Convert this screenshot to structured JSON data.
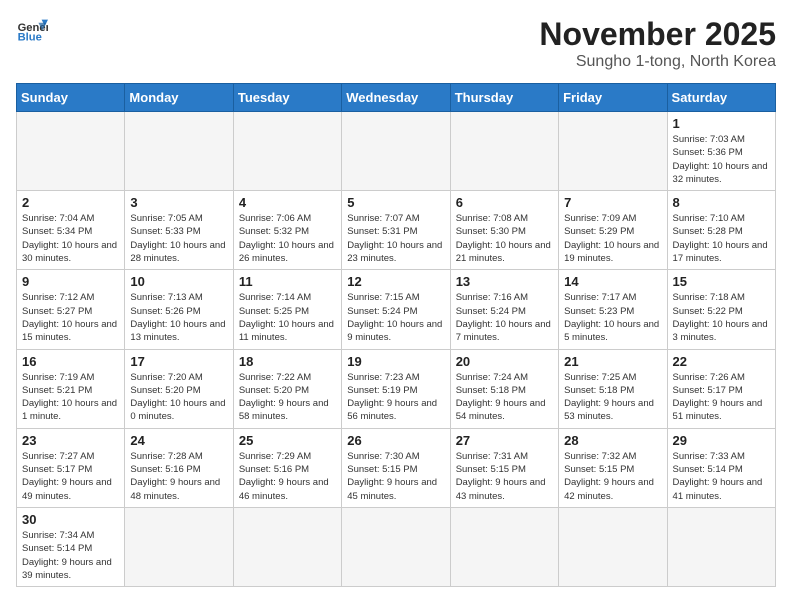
{
  "header": {
    "logo_general": "General",
    "logo_blue": "Blue",
    "month_title": "November 2025",
    "subtitle": "Sungho 1-tong, North Korea"
  },
  "weekdays": [
    "Sunday",
    "Monday",
    "Tuesday",
    "Wednesday",
    "Thursday",
    "Friday",
    "Saturday"
  ],
  "days": {
    "d1": {
      "num": "1",
      "sunrise": "7:03 AM",
      "sunset": "5:36 PM",
      "daylight": "10 hours and 32 minutes."
    },
    "d2": {
      "num": "2",
      "sunrise": "7:04 AM",
      "sunset": "5:34 PM",
      "daylight": "10 hours and 30 minutes."
    },
    "d3": {
      "num": "3",
      "sunrise": "7:05 AM",
      "sunset": "5:33 PM",
      "daylight": "10 hours and 28 minutes."
    },
    "d4": {
      "num": "4",
      "sunrise": "7:06 AM",
      "sunset": "5:32 PM",
      "daylight": "10 hours and 26 minutes."
    },
    "d5": {
      "num": "5",
      "sunrise": "7:07 AM",
      "sunset": "5:31 PM",
      "daylight": "10 hours and 23 minutes."
    },
    "d6": {
      "num": "6",
      "sunrise": "7:08 AM",
      "sunset": "5:30 PM",
      "daylight": "10 hours and 21 minutes."
    },
    "d7": {
      "num": "7",
      "sunrise": "7:09 AM",
      "sunset": "5:29 PM",
      "daylight": "10 hours and 19 minutes."
    },
    "d8": {
      "num": "8",
      "sunrise": "7:10 AM",
      "sunset": "5:28 PM",
      "daylight": "10 hours and 17 minutes."
    },
    "d9": {
      "num": "9",
      "sunrise": "7:12 AM",
      "sunset": "5:27 PM",
      "daylight": "10 hours and 15 minutes."
    },
    "d10": {
      "num": "10",
      "sunrise": "7:13 AM",
      "sunset": "5:26 PM",
      "daylight": "10 hours and 13 minutes."
    },
    "d11": {
      "num": "11",
      "sunrise": "7:14 AM",
      "sunset": "5:25 PM",
      "daylight": "10 hours and 11 minutes."
    },
    "d12": {
      "num": "12",
      "sunrise": "7:15 AM",
      "sunset": "5:24 PM",
      "daylight": "10 hours and 9 minutes."
    },
    "d13": {
      "num": "13",
      "sunrise": "7:16 AM",
      "sunset": "5:24 PM",
      "daylight": "10 hours and 7 minutes."
    },
    "d14": {
      "num": "14",
      "sunrise": "7:17 AM",
      "sunset": "5:23 PM",
      "daylight": "10 hours and 5 minutes."
    },
    "d15": {
      "num": "15",
      "sunrise": "7:18 AM",
      "sunset": "5:22 PM",
      "daylight": "10 hours and 3 minutes."
    },
    "d16": {
      "num": "16",
      "sunrise": "7:19 AM",
      "sunset": "5:21 PM",
      "daylight": "10 hours and 1 minute."
    },
    "d17": {
      "num": "17",
      "sunrise": "7:20 AM",
      "sunset": "5:20 PM",
      "daylight": "10 hours and 0 minutes."
    },
    "d18": {
      "num": "18",
      "sunrise": "7:22 AM",
      "sunset": "5:20 PM",
      "daylight": "9 hours and 58 minutes."
    },
    "d19": {
      "num": "19",
      "sunrise": "7:23 AM",
      "sunset": "5:19 PM",
      "daylight": "9 hours and 56 minutes."
    },
    "d20": {
      "num": "20",
      "sunrise": "7:24 AM",
      "sunset": "5:18 PM",
      "daylight": "9 hours and 54 minutes."
    },
    "d21": {
      "num": "21",
      "sunrise": "7:25 AM",
      "sunset": "5:18 PM",
      "daylight": "9 hours and 53 minutes."
    },
    "d22": {
      "num": "22",
      "sunrise": "7:26 AM",
      "sunset": "5:17 PM",
      "daylight": "9 hours and 51 minutes."
    },
    "d23": {
      "num": "23",
      "sunrise": "7:27 AM",
      "sunset": "5:17 PM",
      "daylight": "9 hours and 49 minutes."
    },
    "d24": {
      "num": "24",
      "sunrise": "7:28 AM",
      "sunset": "5:16 PM",
      "daylight": "9 hours and 48 minutes."
    },
    "d25": {
      "num": "25",
      "sunrise": "7:29 AM",
      "sunset": "5:16 PM",
      "daylight": "9 hours and 46 minutes."
    },
    "d26": {
      "num": "26",
      "sunrise": "7:30 AM",
      "sunset": "5:15 PM",
      "daylight": "9 hours and 45 minutes."
    },
    "d27": {
      "num": "27",
      "sunrise": "7:31 AM",
      "sunset": "5:15 PM",
      "daylight": "9 hours and 43 minutes."
    },
    "d28": {
      "num": "28",
      "sunrise": "7:32 AM",
      "sunset": "5:15 PM",
      "daylight": "9 hours and 42 minutes."
    },
    "d29": {
      "num": "29",
      "sunrise": "7:33 AM",
      "sunset": "5:14 PM",
      "daylight": "9 hours and 41 minutes."
    },
    "d30": {
      "num": "30",
      "sunrise": "7:34 AM",
      "sunset": "5:14 PM",
      "daylight": "9 hours and 39 minutes."
    }
  },
  "labels": {
    "sunrise": "Sunrise:",
    "sunset": "Sunset:",
    "daylight": "Daylight:"
  }
}
